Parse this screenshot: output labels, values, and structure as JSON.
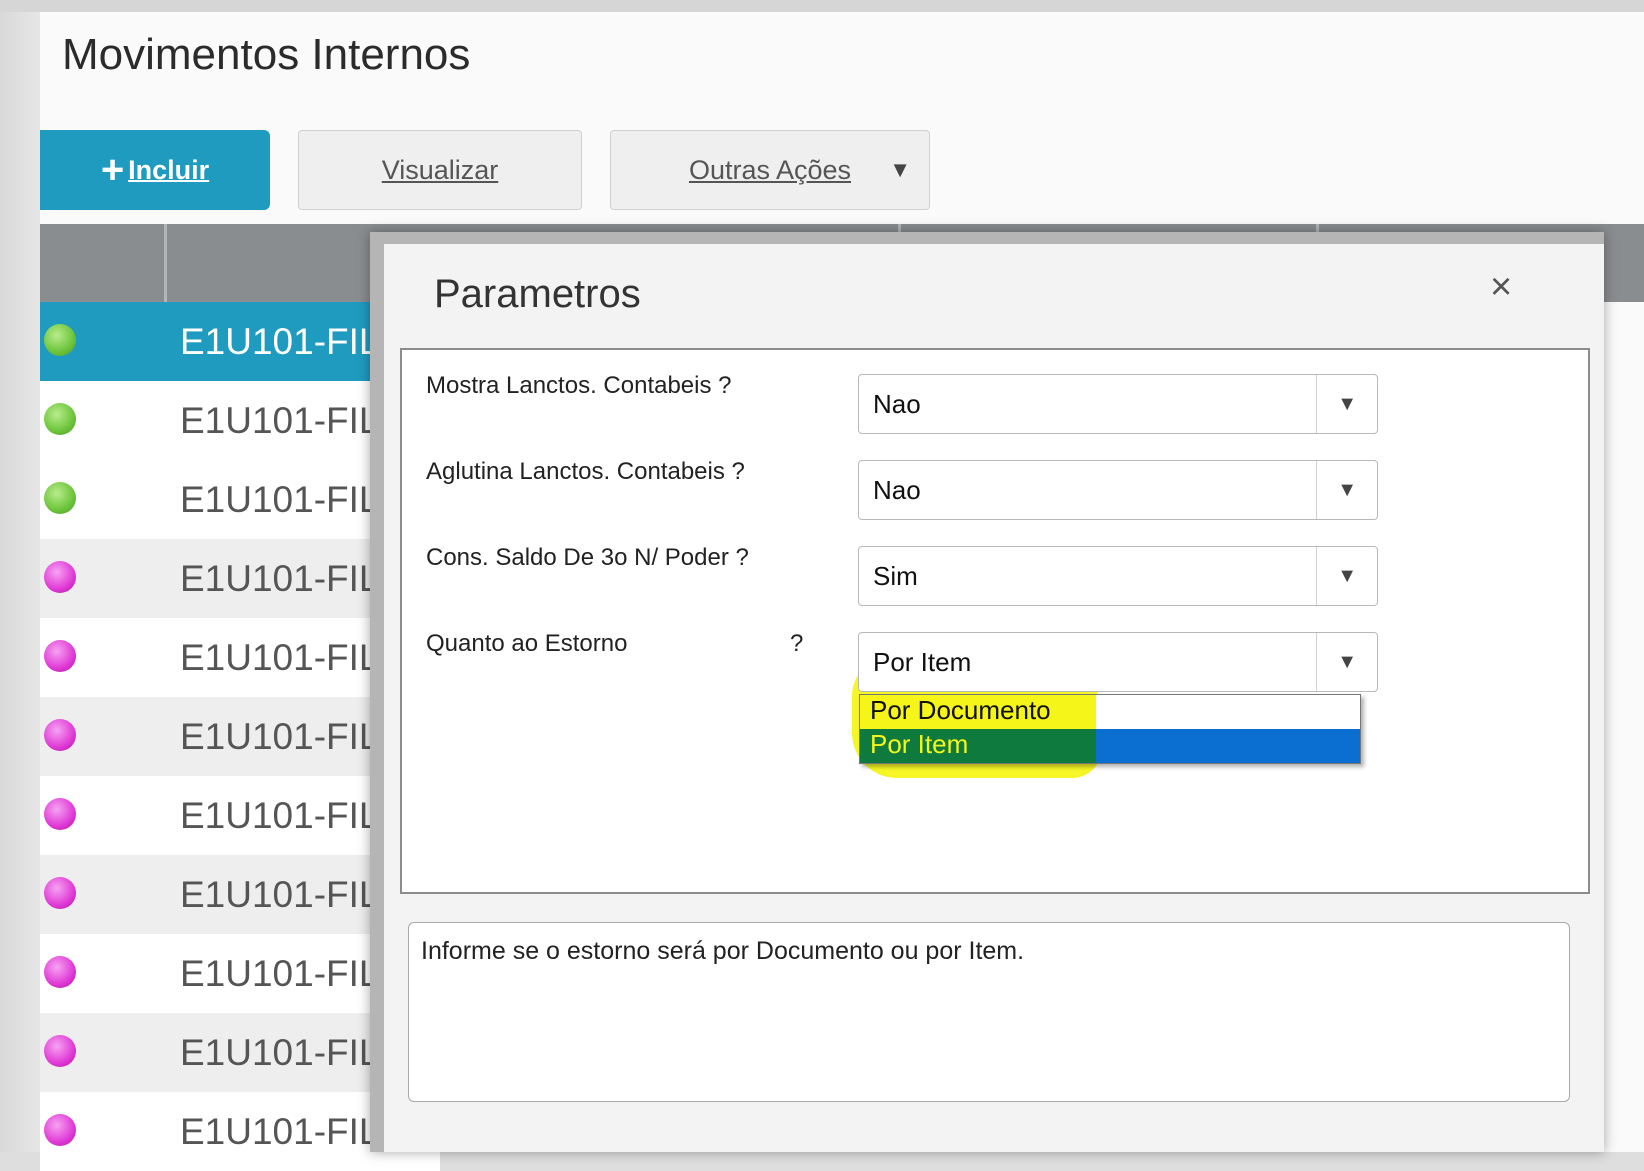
{
  "page": {
    "title": "Movimentos Internos"
  },
  "toolbar": {
    "incluir_label": "Incluir",
    "visualizar_label": "Visualizar",
    "outras_label": "Outras Ações"
  },
  "grid": {
    "rows": [
      {
        "status": "green",
        "text": "E1U101-FIL"
      },
      {
        "status": "green",
        "text": "E1U101-FIL"
      },
      {
        "status": "green",
        "text": "E1U101-FIL"
      },
      {
        "status": "magenta",
        "text": "E1U101-FIL"
      },
      {
        "status": "magenta",
        "text": "E1U101-FIL"
      },
      {
        "status": "magenta",
        "text": "E1U101-FIL"
      },
      {
        "status": "magenta",
        "text": "E1U101-FIL"
      },
      {
        "status": "magenta",
        "text": "E1U101-FIL"
      },
      {
        "status": "magenta",
        "text": "E1U101-FIL"
      },
      {
        "status": "magenta",
        "text": "E1U101-FIL"
      },
      {
        "status": "magenta",
        "text": "E1U101-FIL"
      }
    ]
  },
  "modal": {
    "title": "Parametros",
    "close_icon": "×",
    "params": [
      {
        "label": "Mostra Lanctos. Contabeis ?",
        "value": "Nao"
      },
      {
        "label": "Aglutina Lanctos. Contabeis ?",
        "value": "Nao"
      },
      {
        "label": "Cons. Saldo De 3o N/ Poder ?",
        "value": "Sim"
      },
      {
        "label": "Quanto ao Estorno",
        "question": "?",
        "value": "Por Item"
      }
    ],
    "dropdown_options": [
      "Por Documento",
      "Por Item"
    ],
    "help_text": "Informe se o estorno será por Documento ou por Item."
  },
  "colors": {
    "accent": "#1f9bc0",
    "status_green": "#6cc43a",
    "status_magenta": "#e03ad6",
    "highlight": "#f5f51a",
    "dropdown_selected": "#0a6fd0"
  },
  "icons": {
    "plus": "plus-icon",
    "caret": "chevron-down-icon",
    "close": "close-icon"
  }
}
